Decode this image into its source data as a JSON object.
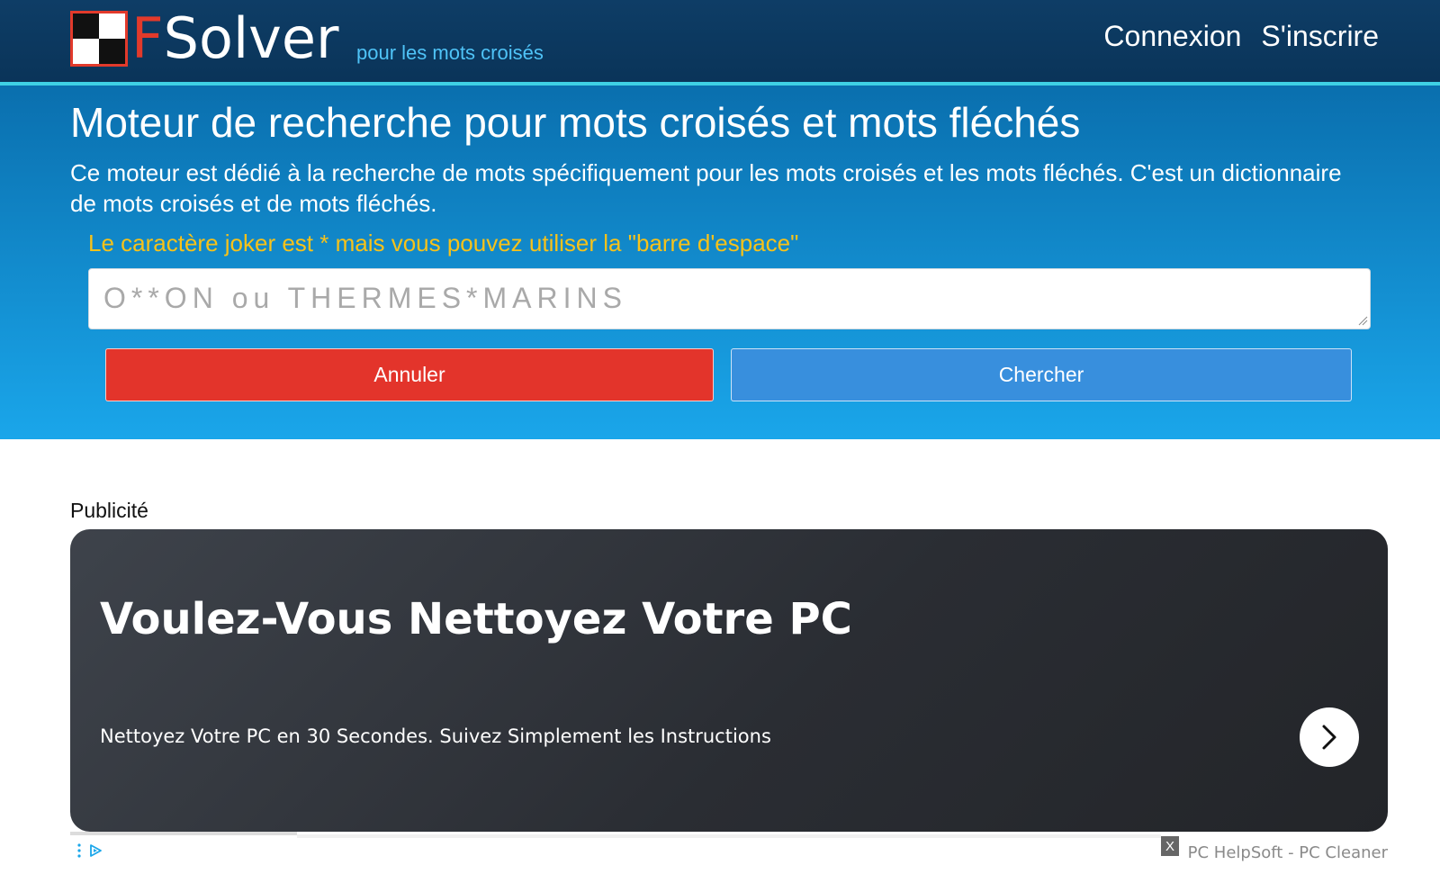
{
  "header": {
    "logo_f": "F",
    "logo_solver": "Solver",
    "tagline": "pour les mots croisés",
    "nav": {
      "login": "Connexion",
      "signup": "S'inscrire"
    }
  },
  "hero": {
    "title": "Moteur de recherche pour mots croisés et mots fléchés",
    "description": "Ce moteur est dédié à la recherche de mots spécifiquement pour les mots croisés et les mots fléchés. C'est un dictionnaire de mots croisés et de mots fléchés.",
    "hint": "Le caractère joker est * mais vous pouvez utiliser la \"barre d'espace\"",
    "search": {
      "placeholder": "O**ON ou THERMES*MARINS",
      "value": ""
    },
    "buttons": {
      "cancel": "Annuler",
      "search": "Chercher"
    }
  },
  "ad": {
    "label": "Publicité",
    "title": "Voulez-Vous Nettoyez Votre PC",
    "subtitle": "Nettoyez Votre PC en 30 Secondes. Suivez Simplement les Instructions",
    "close": "X",
    "sponsor": "PC HelpSoft - PC Cleaner"
  },
  "colors": {
    "header_bg": "#0e3d66",
    "accent_line": "#3fd0e4",
    "hint": "#f7c21a",
    "cancel": "#e3342b",
    "search": "#388fdd"
  }
}
